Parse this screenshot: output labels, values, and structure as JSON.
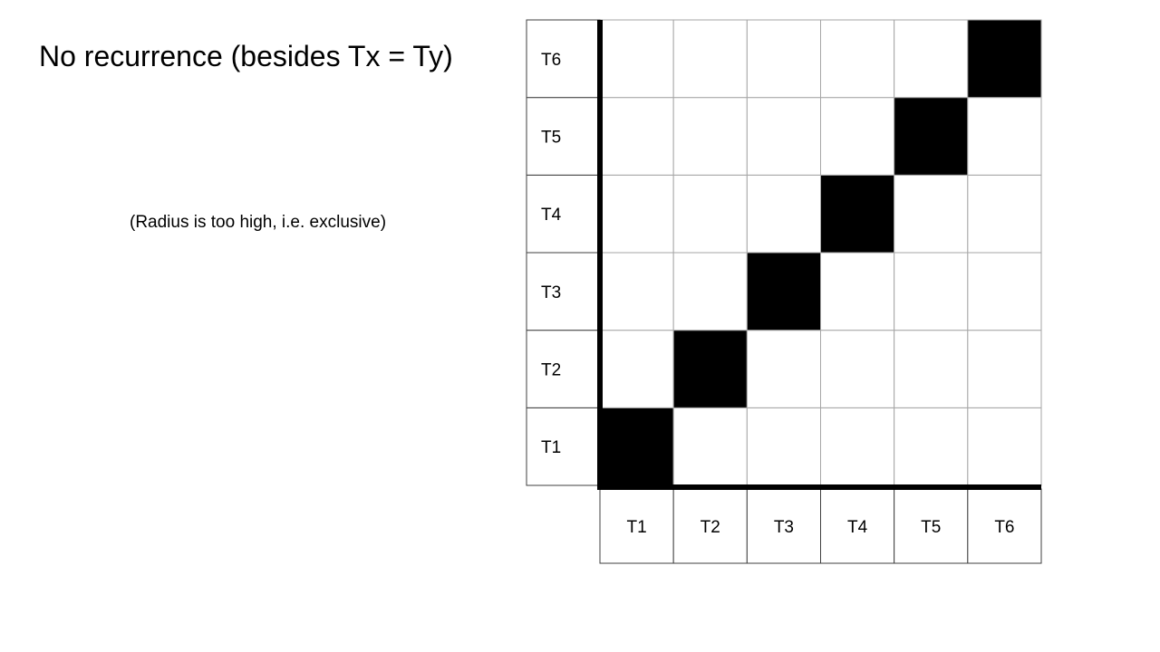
{
  "slide": {
    "title": "No recurrence (besides Tx = Ty)",
    "subtitle": "(Radius is too high, i.e. exclusive)"
  },
  "chart_data": {
    "type": "heatmap",
    "x_labels": [
      "T1",
      "T2",
      "T3",
      "T4",
      "T5",
      "T6"
    ],
    "y_labels": [
      "T1",
      "T2",
      "T3",
      "T4",
      "T5",
      "T6"
    ],
    "recurrent_cells": [
      [
        0,
        0
      ],
      [
        1,
        1
      ],
      [
        2,
        2
      ],
      [
        3,
        3
      ],
      [
        4,
        4
      ],
      [
        5,
        5
      ]
    ],
    "colors": {
      "recurrent": "#000000",
      "empty": "#ffffff",
      "grid": "#a6a6a6",
      "axis": "#000000"
    }
  }
}
